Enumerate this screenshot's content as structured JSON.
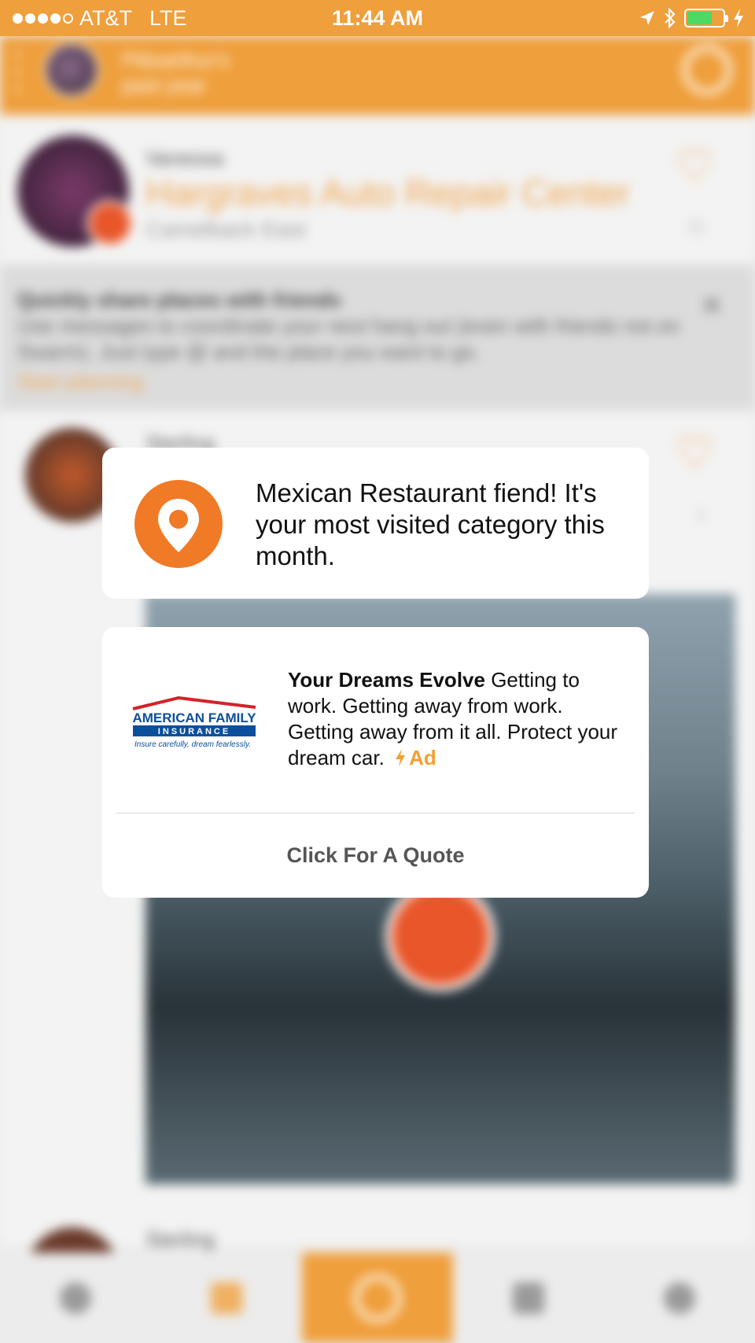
{
  "status_bar": {
    "carrier": "AT&T",
    "network": "LTE",
    "time": "11:44 AM",
    "signal_bars_filled": 4,
    "signal_bars_total": 5,
    "battery_level": 0.7
  },
  "app_header": {
    "title_line1": "Pittsarthur's",
    "title_line2": "past year"
  },
  "feed": {
    "item1": {
      "name": "Vanessa",
      "venue": "Hargraves Auto Repair Center",
      "area": "Camelback East",
      "count": "21"
    },
    "tip": {
      "title": "Quickly share places with friends",
      "body": "Use messages to coordinate your next hang out (even with friends not on Swarm). Just type @ and the place you want to go.",
      "link": "Start planning"
    },
    "item2": {
      "name": "Sterling",
      "count": "1"
    },
    "item3": {
      "name": "Sterling"
    }
  },
  "insight_card": {
    "icon": "location-pin-icon",
    "text": "Mexican Restaurant fiend!  It's your most visited category this month."
  },
  "ad_card": {
    "logo": {
      "line1": "AMERICAN FAMILY",
      "line2": "INSURANCE",
      "tagline": "Insure carefully, dream fearlessly."
    },
    "headline": "Your Dreams Evolve",
    "body": " Getting to work. Getting away from work. Getting away from it all. Protect your dream car.",
    "ad_label": "Ad",
    "cta": "Click For A Quote"
  },
  "colors": {
    "brand_orange": "#ef9f3c",
    "pin_orange": "#f07a26",
    "ad_tag": "#f2a030",
    "logo_red": "#d4232a",
    "logo_blue": "#0b4f9c"
  },
  "tab_bar": {
    "tabs": [
      "globe-icon",
      "list-icon",
      "check-in-icon",
      "history-icon",
      "profile-icon"
    ],
    "active_index": 2
  }
}
